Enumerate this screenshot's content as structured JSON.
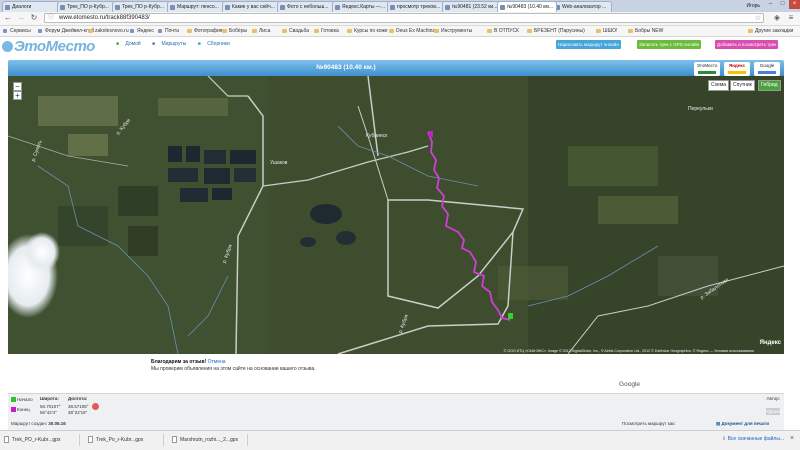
{
  "browser": {
    "tabs": [
      {
        "label": "Диалоги"
      },
      {
        "label": "Трек_ПО р-Кубр..."
      },
      {
        "label": "Трек_ПО р-Кубр..."
      },
      {
        "label": "Маршрут: пенсо..."
      },
      {
        "label": "Какие у вас сейч..."
      },
      {
        "label": "Фото с небольш..."
      },
      {
        "label": "Яндекс.Карты —..."
      },
      {
        "label": "просмотр треков..."
      },
      {
        "label": "№90481 (23.52 ки..."
      },
      {
        "label": "№90483 (10.40 км..."
      },
      {
        "label": "Web-анализатор ..."
      }
    ],
    "user": "Игорь",
    "url": "www.etomesto.ru/track88f390483/",
    "bookmarks": [
      {
        "label": "Сервисы",
        "icon": "apps-icon"
      },
      {
        "label": "Форум Джейвел-клуб",
        "icon": "page-icon"
      },
      {
        "label": "zakolesnovo.ru",
        "icon": "folder-icon"
      },
      {
        "label": "Яндекс",
        "icon": "page-icon"
      },
      {
        "label": "Почта",
        "icon": "page-icon"
      },
      {
        "label": "Фотография",
        "icon": "folder-icon"
      },
      {
        "label": "Бобёры",
        "icon": "folder-icon"
      },
      {
        "label": "Лиса",
        "icon": "folder-icon"
      },
      {
        "label": "Свадьба",
        "icon": "folder-icon"
      },
      {
        "label": "Готовка",
        "icon": "folder-icon"
      },
      {
        "label": "Курсы по коже",
        "icon": "folder-icon"
      },
      {
        "label": "Deus Ex Machina",
        "icon": "folder-icon"
      },
      {
        "label": "Инструменты",
        "icon": "folder-icon"
      },
      {
        "label": "В ОТПУСК",
        "icon": "folder-icon"
      },
      {
        "label": "БРЕЗЕНТ (Парусины)",
        "icon": "folder-icon"
      },
      {
        "label": "ШШО!",
        "icon": "folder-icon"
      },
      {
        "label": "Бобры NEW",
        "icon": "folder-icon"
      },
      {
        "label": "Другие закладки",
        "icon": "folder-icon"
      }
    ]
  },
  "site": {
    "logo": "ЭтоМесто",
    "nav": [
      {
        "label": "Домой"
      },
      {
        "label": "Маршруты"
      },
      {
        "label": "Сборники"
      }
    ],
    "buttons": {
      "draw": "Нарисовать маршрут онлайн",
      "record": "Записать трек с GPS онлайн",
      "add": "Добавить и посмотреть трек"
    }
  },
  "map": {
    "title": "№90483 (10.40 км.)",
    "providers": [
      "ЭтоМесто",
      "Яндекс",
      "Google"
    ],
    "types": [
      "Схема",
      "Спутник",
      "Гибрид"
    ],
    "zoom_in": "+",
    "zoom_out": "−",
    "places": [
      {
        "label": "Кубринск"
      },
      {
        "label": "Переульки"
      },
      {
        "label": "р. Кубря"
      },
      {
        "label": "р. Сулоть"
      },
      {
        "label": "р. Кубря"
      },
      {
        "label": "р. Кубря"
      },
      {
        "label": "р. Забалотная"
      },
      {
        "label": "Ушаков"
      }
    ],
    "attribution": "© ООО ИТЦ «СКАНЭКС», Image © 2012 DigitalGlobe, Inc., © Airbis Corporation Ltd., 2012 © Earthstar Geographics, © Яндекс — Условия использования",
    "yandex_mark": "Яндекс",
    "track_color": "#d23fd6"
  },
  "ad": {
    "title": "Благодарим за отзыв!",
    "cancel": "Отмена",
    "text": "Мы проверим объявления на этом сайте на основании вашего отзыва.",
    "brand": "Google"
  },
  "info": {
    "start_label": "Начало",
    "end_label": "Конец",
    "lat_header": "Широта:",
    "lon_header": "Долгота:",
    "start_lat": "56.70107°",
    "start_lon": "38.57108°",
    "end_lat": "56°42'4\"",
    "end_lon": "38°22'16\"",
    "created_label": "Маршрут создан:",
    "created_date": "30.05.16",
    "author_label": "Автор:",
    "author_value": "",
    "view_label": "Посмотреть маршрут как:",
    "print_doc": "Документ для печати",
    "delete": "Удалить"
  },
  "downloads": {
    "files": [
      {
        "label": "Trek_PO_r-Kubr...gpx"
      },
      {
        "label": "Trek_Po_r-Kubr...gpx"
      },
      {
        "label": "Marshrutn_rozhi..._2...gpx"
      }
    ],
    "show_all": "Все скачанные файлы..."
  }
}
